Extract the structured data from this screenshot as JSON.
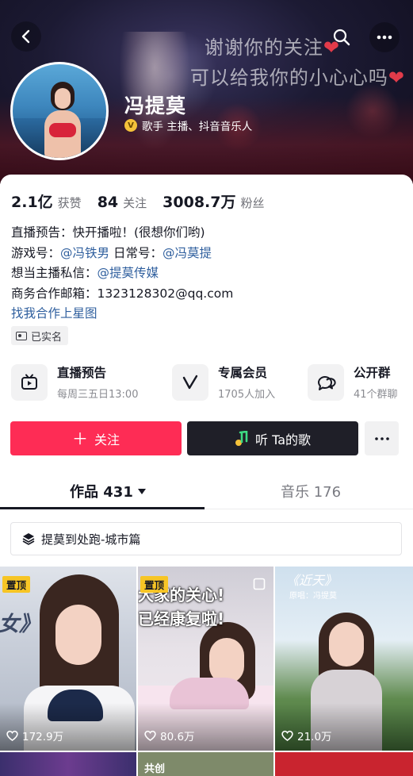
{
  "header": {
    "banner_line1": "谢谢你的关注",
    "banner_line2": "可以给我你的小心心吗",
    "heart": "❤",
    "name": "冯提莫",
    "verified_badge": "V",
    "verified_text": "歌手  主播、抖音音乐人"
  },
  "stats": [
    {
      "num": "2.1亿",
      "label": "获赞"
    },
    {
      "num": "84",
      "label": "关注"
    },
    {
      "num": "3008.7万",
      "label": "粉丝"
    }
  ],
  "bio": {
    "line1": "直播预告：快开播啦！(很想你们哟)",
    "line2_prefix": "游戏号：",
    "line2_link1": "@冯铁男",
    "line2_mid": "  日常号：",
    "line2_link2": "@冯莫提",
    "line3_prefix": "想当主播私信：",
    "line3_link": "@提莫传媒",
    "line4": "商务合作邮箱：1323128302@qq.com",
    "line5_link": "找我合作上星图"
  },
  "realname_label": "已实名",
  "features": [
    {
      "title": "直播预告",
      "sub": "每周三五日13:00",
      "icon": "tv-icon"
    },
    {
      "title": "专属会员",
      "sub": "1705人加入",
      "icon": "v-icon"
    },
    {
      "title": "公开群",
      "sub": "41个群聊",
      "icon": "chat-icon"
    }
  ],
  "actions": {
    "follow": "关注",
    "listen": "听 Ta的歌"
  },
  "tabs": {
    "works": "作品 431",
    "music": "音乐 176"
  },
  "collection_label": "提莫到处跑-城市篇",
  "videos": [
    {
      "pinned": "置顶",
      "likes": "172.9万",
      "overlay": "女》"
    },
    {
      "pinned": "置顶",
      "likes": "80.6万",
      "overlay1": "大家的关心!",
      "overlay2": "已经康复啦!"
    },
    {
      "likes": "21.0万",
      "overlay1": "《近天》",
      "overlay2": "原唱：冯提莫"
    }
  ],
  "second_row_tag": "共创",
  "colors": {
    "accent": "#fe2c55",
    "link": "#2f5f9e",
    "pin": "#f7c525",
    "dark_button": "#1f1f28"
  }
}
